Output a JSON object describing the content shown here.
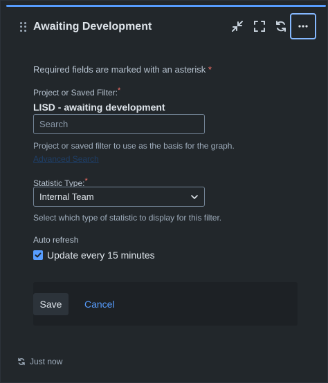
{
  "gadget": {
    "title": "Awaiting Development",
    "accent_color": "#579dff",
    "icons": [
      "drag-handle-icon",
      "minimize-icon",
      "fullscreen-icon",
      "refresh-icon",
      "more-icon"
    ]
  },
  "form": {
    "required_note": "Required fields are marked with an asterisk",
    "required_star": "*",
    "project_label": "Project or Saved Filter:",
    "project_value": "LISD - awaiting development",
    "search_placeholder": "Search",
    "project_helper": "Project or saved filter to use as the basis for the graph.",
    "advanced_link": "Advanced Search",
    "statistic_label": "Statistic Type:",
    "statistic_value": "Internal Team",
    "statistic_helper": "Select which type of statistic to display for this filter.",
    "auto_refresh_label": "Auto refresh",
    "auto_refresh_option": "Update every 15 minutes",
    "auto_refresh_checked": true
  },
  "footer": {
    "save_label": "Save",
    "cancel_label": "Cancel"
  },
  "status": {
    "last_refreshed": "Just now"
  }
}
